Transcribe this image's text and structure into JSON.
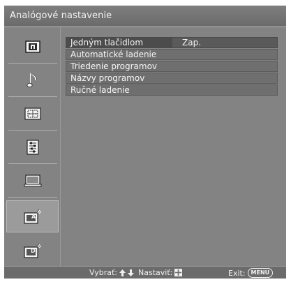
{
  "header": {
    "title": "Analógové nastavenie"
  },
  "sidebar": {
    "items": [
      {
        "icon": "picture-icon",
        "active": false
      },
      {
        "icon": "sound-icon",
        "active": false
      },
      {
        "icon": "screen-icon",
        "active": false
      },
      {
        "icon": "settings-list-icon",
        "active": false
      },
      {
        "icon": "pc-monitor-icon",
        "active": false
      },
      {
        "icon": "analog-setup-icon",
        "active": true,
        "glyph": "A"
      },
      {
        "icon": "digital-setup-icon",
        "active": false,
        "glyph": "D"
      }
    ]
  },
  "menu": {
    "items": [
      {
        "label": "Jedným tlačidlom",
        "value": "Zap."
      },
      {
        "label": "Automatické ladenie",
        "value": ""
      },
      {
        "label": "Triedenie programov",
        "value": ""
      },
      {
        "label": "Názvy programov",
        "value": ""
      },
      {
        "label": "Ručné ladenie",
        "value": ""
      }
    ]
  },
  "footer": {
    "select_label": "Vybrať:",
    "set_label": "Nastaviť:",
    "exit_label": "Exit:",
    "menu_key": "MENU"
  },
  "colors": {
    "background": "#838383",
    "title_bar": "#6f6f6f",
    "row": "#6f6f6f",
    "selected_cell": "#4c4c4c",
    "text": "#f5f5f5"
  }
}
